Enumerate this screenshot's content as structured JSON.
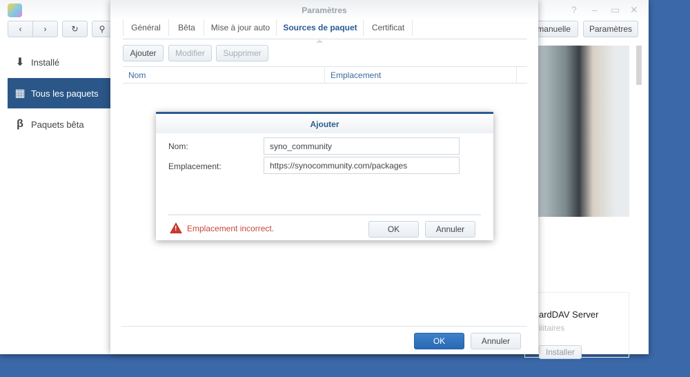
{
  "main_window": {
    "sidebar": [
      {
        "label": "Installé",
        "icon": "download-icon"
      },
      {
        "label": "Tous les paquets",
        "icon": "grid-icon"
      },
      {
        "label": "Paquets bêta",
        "icon": "beta-icon"
      }
    ],
    "toolbar": {
      "manual_label": "manuelle",
      "settings_label": "Paramètres"
    },
    "window_controls": {
      "help": "?",
      "minimize": "–",
      "maximize": "▭",
      "close": "✕"
    },
    "card": {
      "title": "ardDAV Server",
      "category": "ilitaires",
      "install_label": "Installer"
    }
  },
  "settings_dialog": {
    "title": "Paramètres",
    "tabs": [
      {
        "label": "Général"
      },
      {
        "label": "Bêta"
      },
      {
        "label": "Mise à jour auto"
      },
      {
        "label": "Sources de paquet",
        "active": true
      },
      {
        "label": "Certificat"
      }
    ],
    "buttons": {
      "add": "Ajouter",
      "edit": "Modifier",
      "delete": "Supprimer"
    },
    "columns": [
      "Nom",
      "Emplacement"
    ],
    "ok": "OK",
    "cancel": "Annuler"
  },
  "add_dialog": {
    "title": "Ajouter",
    "name_label": "Nom:",
    "name_value": "syno_community",
    "location_label": "Emplacement:",
    "location_value": "https://synocommunity.com/packages",
    "error": "Emplacement incorrect.",
    "ok": "OK",
    "cancel": "Annuler"
  },
  "colors": {
    "desktop": "#3a68a8",
    "accent": "#2b5688",
    "error": "#c0392b"
  }
}
